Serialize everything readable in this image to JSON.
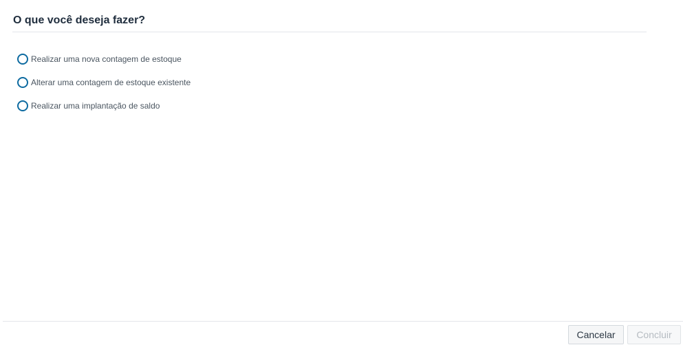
{
  "dialog": {
    "title": "O que você deseja fazer?",
    "options": [
      {
        "label": "Realizar uma nova contagem de estoque",
        "selected": false
      },
      {
        "label": "Alterar uma contagem de estoque existente",
        "selected": false
      },
      {
        "label": "Realizar uma implantação de saldo",
        "selected": false
      }
    ],
    "buttons": {
      "cancel_label": "Cancelar",
      "confirm_label": "Concluir",
      "confirm_disabled": true
    }
  },
  "colors": {
    "title_text": "#1f2d3d",
    "radio_border": "#0c6aa0",
    "option_text": "#4a5560",
    "divider": "#e3e6ea",
    "disabled_text": "#b5bbc1"
  }
}
